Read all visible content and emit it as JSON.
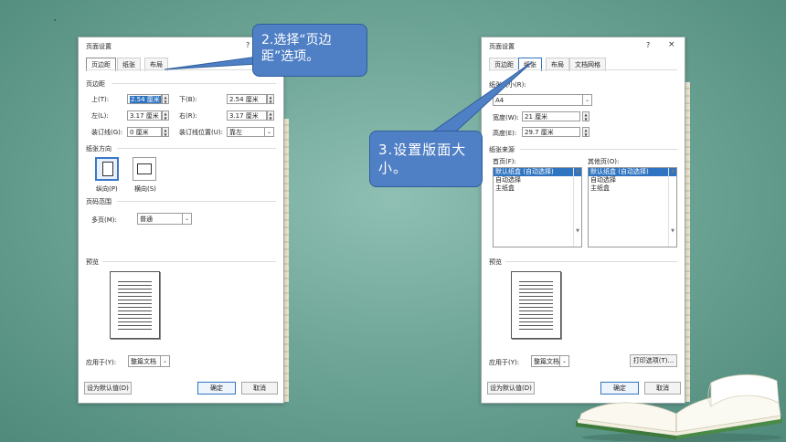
{
  "left_dialog": {
    "title": "页面设置",
    "help": "?",
    "tabs": [
      "页边距",
      "纸张",
      "布局"
    ],
    "section_margins": "页边距",
    "top_label": "上(T):",
    "top_value": "2.54 厘米",
    "bottom_label": "下(B):",
    "bottom_value": "2.54 厘米",
    "left_label": "左(L):",
    "left_value": "3.17 厘米",
    "right_label": "右(R):",
    "right_value": "3.17 厘米",
    "gutter_label": "装订线(G):",
    "gutter_value": "0 厘米",
    "gutter_pos_label": "装订线位置(U):",
    "gutter_pos_value": "靠左",
    "section_orientation": "纸张方向",
    "portrait_label": "纵向(P)",
    "landscape_label": "横向(S)",
    "section_pages": "页码范围",
    "multi_pages_label": "多页(M):",
    "multi_pages_value": "普通",
    "section_preview": "预览",
    "apply_label": "应用于(Y):",
    "apply_value": "整篇文档",
    "default_button": "设为默认值(D)",
    "ok_button": "确定",
    "cancel_button": "取消"
  },
  "right_dialog": {
    "title": "页面设置",
    "help": "?",
    "close": "×",
    "tabs": [
      "页边距",
      "纸张",
      "布局",
      "文档网格"
    ],
    "paper_size_label": "纸张大小(R):",
    "paper_size_value": "A4",
    "width_label": "宽度(W):",
    "width_value": "21 厘米",
    "height_label": "高度(E):",
    "height_value": "29.7 厘米",
    "section_source": "纸张来源",
    "first_page_label": "首页(F):",
    "other_pages_label": "其他页(O):",
    "first_page_items": [
      "默认纸盒 (自动选择)",
      "自动选择",
      "主纸盒"
    ],
    "other_pages_items": [
      "默认纸盒 (自动选择)",
      "自动选择",
      "主纸盒"
    ],
    "section_preview": "预览",
    "apply_label": "应用于(Y):",
    "apply_value": "整篇文档",
    "print_options_button": "打印选项(T)...",
    "default_button": "设为默认值(D)",
    "ok_button": "确定",
    "cancel_button": "取消"
  },
  "callouts": {
    "step2": "2.选择“页边距”选项。",
    "step3": "3.设置版面大小。"
  },
  "colors": {
    "callout_fill": "#4f7fc4",
    "selection": "#2f74c0",
    "background": "#6fa697"
  }
}
